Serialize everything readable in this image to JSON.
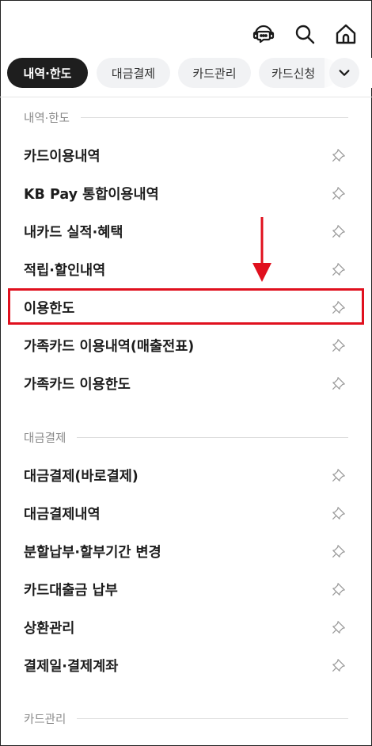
{
  "header": {
    "icons": [
      "chatbot-icon",
      "search-icon",
      "home-icon"
    ]
  },
  "tabs": [
    {
      "label": "내역·한도",
      "active": true
    },
    {
      "label": "대금결제",
      "active": false
    },
    {
      "label": "카드관리",
      "active": false
    },
    {
      "label": "카드신청",
      "active": false
    }
  ],
  "sections": [
    {
      "title": "내역·한도",
      "items": [
        {
          "label": "카드이용내역"
        },
        {
          "label": "KB Pay 통합이용내역"
        },
        {
          "label": "내카드 실적·혜택"
        },
        {
          "label": "적립·할인내역"
        },
        {
          "label": "이용한도",
          "highlighted": true
        },
        {
          "label": "가족카드 이용내역(매출전표)"
        },
        {
          "label": "가족카드 이용한도"
        }
      ]
    },
    {
      "title": "대금결제",
      "items": [
        {
          "label": "대금결제(바로결제)"
        },
        {
          "label": "대금결제내역"
        },
        {
          "label": "분할납부·할부기간 변경"
        },
        {
          "label": "카드대출금 납부"
        },
        {
          "label": "상환관리"
        },
        {
          "label": "결제일·결제계좌"
        }
      ]
    },
    {
      "title": "카드관리",
      "items": []
    }
  ],
  "colors": {
    "active_tab_bg": "#1e1e1e",
    "tab_bg": "#f1f2f4",
    "annotation_red": "#e0101e"
  }
}
